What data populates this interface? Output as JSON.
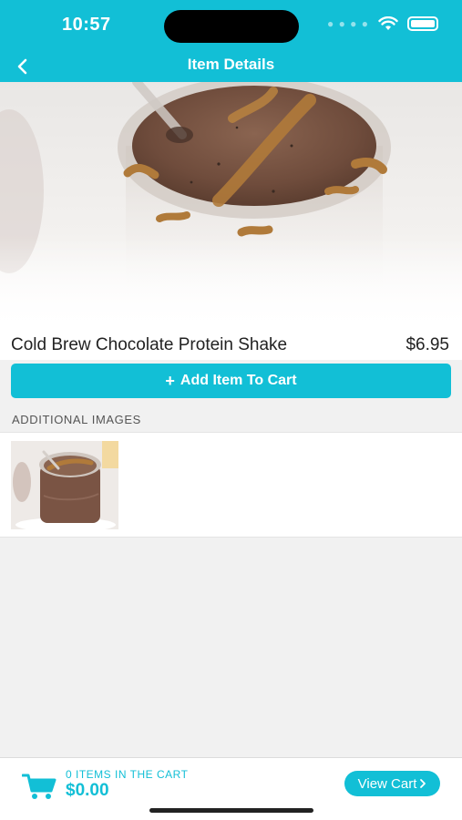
{
  "status_bar": {
    "time": "10:57"
  },
  "nav": {
    "title": "Item Details",
    "back_icon": "chevron-left-icon"
  },
  "item": {
    "name": "Cold Brew Chocolate Protein Shake",
    "price": "$6.95",
    "hero_image": "chocolate-protein-shake-photo"
  },
  "actions": {
    "add_to_cart": "Add Item To Cart",
    "add_icon": "plus-icon"
  },
  "additional_images": {
    "label": "ADDITIONAL IMAGES",
    "thumbnails": [
      "chocolate-protein-shake-thumbnail"
    ]
  },
  "cart": {
    "count_text": "0 ITEMS IN THE CART",
    "total": "$0.00",
    "view_cart": "View Cart",
    "cart_icon": "shopping-cart-icon"
  },
  "colors": {
    "accent": "#12bfd6",
    "background": "#f1f1f1"
  }
}
